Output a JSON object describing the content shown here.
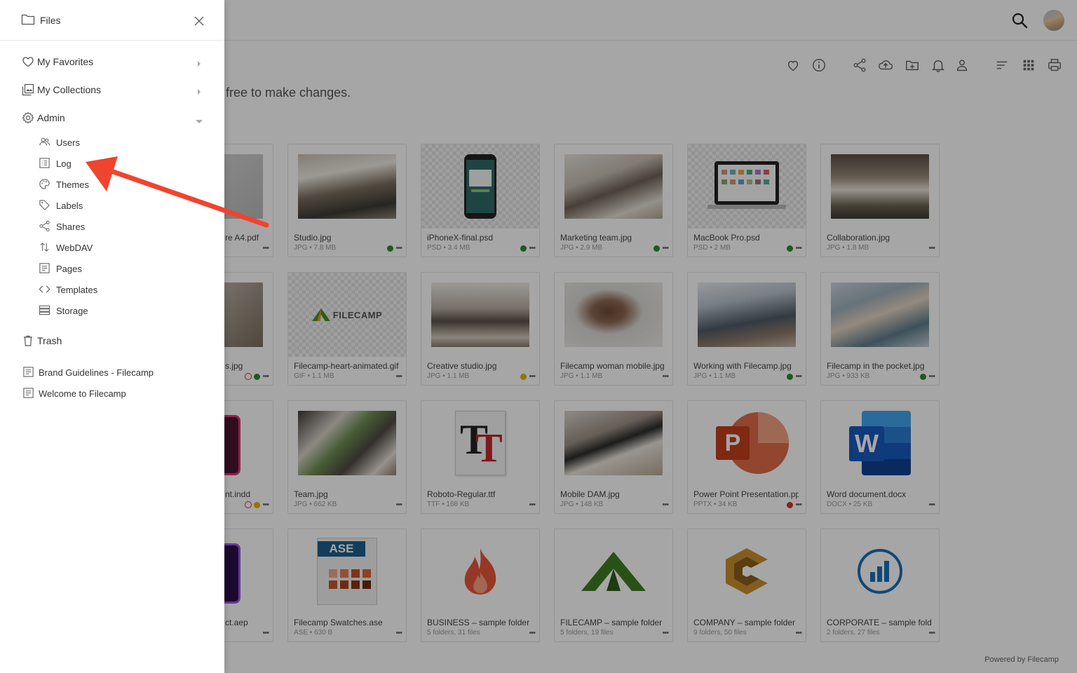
{
  "drawer": {
    "title": "Files",
    "items": [
      {
        "label": "My Favorites",
        "icon": "heart-icon"
      },
      {
        "label": "My Collections",
        "icon": "collections-icon"
      },
      {
        "label": "Admin",
        "icon": "gear-icon"
      }
    ],
    "admin_items": [
      {
        "label": "Users",
        "icon": "users-icon"
      },
      {
        "label": "Log",
        "icon": "log-icon"
      },
      {
        "label": "Themes",
        "icon": "palette-icon"
      },
      {
        "label": "Labels",
        "icon": "tag-icon"
      },
      {
        "label": "Shares",
        "icon": "share-icon"
      },
      {
        "label": "WebDAV",
        "icon": "webdav-icon"
      },
      {
        "label": "Pages",
        "icon": "page-icon"
      },
      {
        "label": "Templates",
        "icon": "code-icon"
      },
      {
        "label": "Storage",
        "icon": "storage-icon"
      }
    ],
    "trash": {
      "label": "Trash",
      "icon": "trash-icon"
    },
    "pages": [
      {
        "label": "Brand Guidelines - Filecamp",
        "icon": "page-icon"
      },
      {
        "label": "Welcome to Filecamp",
        "icon": "page-icon"
      }
    ]
  },
  "main": {
    "description": "free to make changes.",
    "toolbar_icons": [
      "heart-icon",
      "info-icon",
      "share-icon",
      "upload-icon",
      "new-folder-icon",
      "bell-icon",
      "user-icon",
      "sort-icon",
      "grid-icon",
      "print-icon"
    ],
    "powered_by": "Powered by Filecamp",
    "files": [
      {
        "name": "re A4.pdf",
        "meta": "",
        "status": ""
      },
      {
        "name": "Studio.jpg",
        "meta": "JPG • 7.8 MB",
        "status": "green"
      },
      {
        "name": "iPhoneX-final.psd",
        "meta": "PSD • 3.4 MB",
        "status": "green"
      },
      {
        "name": "Marketing team.jpg",
        "meta": "JPG • 2.9 MB",
        "status": "green"
      },
      {
        "name": "MacBook Pro.psd",
        "meta": "PSD • 2 MB",
        "status": "green"
      },
      {
        "name": "Collaboration.jpg",
        "meta": "JPG • 1.8 MB",
        "status": ""
      },
      {
        "name": "s.jpg",
        "meta": "",
        "status": "green",
        "clock": true
      },
      {
        "name": "Filecamp-heart-animated.gif",
        "meta": "GIF • 1.1 MB",
        "status": ""
      },
      {
        "name": "Creative studio.jpg",
        "meta": "JPG • 1.1 MB",
        "status": "yellow"
      },
      {
        "name": "Filecamp woman mobile.jpg",
        "meta": "JPG • 1.1 MB",
        "status": ""
      },
      {
        "name": "Working with Filecamp.jpg",
        "meta": "JPG • 1.1 MB",
        "status": "green"
      },
      {
        "name": "Filecamp in the pocket.jpg",
        "meta": "JPG • 933 KB",
        "status": "green"
      },
      {
        "name": "nt.indd",
        "meta": "",
        "status": "yellow",
        "clock": true
      },
      {
        "name": "Team.jpg",
        "meta": "JPG • 662 KB",
        "status": ""
      },
      {
        "name": "Roboto-Regular.ttf",
        "meta": "TTF • 168 KB",
        "status": ""
      },
      {
        "name": "Mobile DAM.jpg",
        "meta": "JPG • 148 KB",
        "status": ""
      },
      {
        "name": "Power Point Presentation.pptx",
        "meta": "PPTX • 34 KB",
        "status": "red"
      },
      {
        "name": "Word document.docx",
        "meta": "DOCX • 25 KB",
        "status": ""
      },
      {
        "name": "ct.aep",
        "meta": "",
        "status": ""
      },
      {
        "name": "Filecamp Swatches.ase",
        "meta": "ASE • 630 B",
        "status": ""
      },
      {
        "name": "BUSINESS – sample folder",
        "meta": "5 folders, 31 files",
        "status": ""
      },
      {
        "name": "FILECAMP – sample folder",
        "meta": "5 folders, 19 files",
        "status": ""
      },
      {
        "name": "COMPANY – sample folder",
        "meta": "9 folders, 50 files",
        "status": ""
      },
      {
        "name": "CORPORATE – sample folder",
        "meta": "2 folders, 27 files",
        "status": ""
      }
    ],
    "thumb_texts": {
      "filecamp_logo": "FILECAMP",
      "ase_label": "ASE",
      "font_glyph": "T",
      "ppt_letter": "P",
      "word_letter": "W"
    }
  },
  "colors": {
    "green": "#2e8b2e",
    "yellow": "#e0b400",
    "red": "#d9302c",
    "arrow": "#f0442e"
  }
}
